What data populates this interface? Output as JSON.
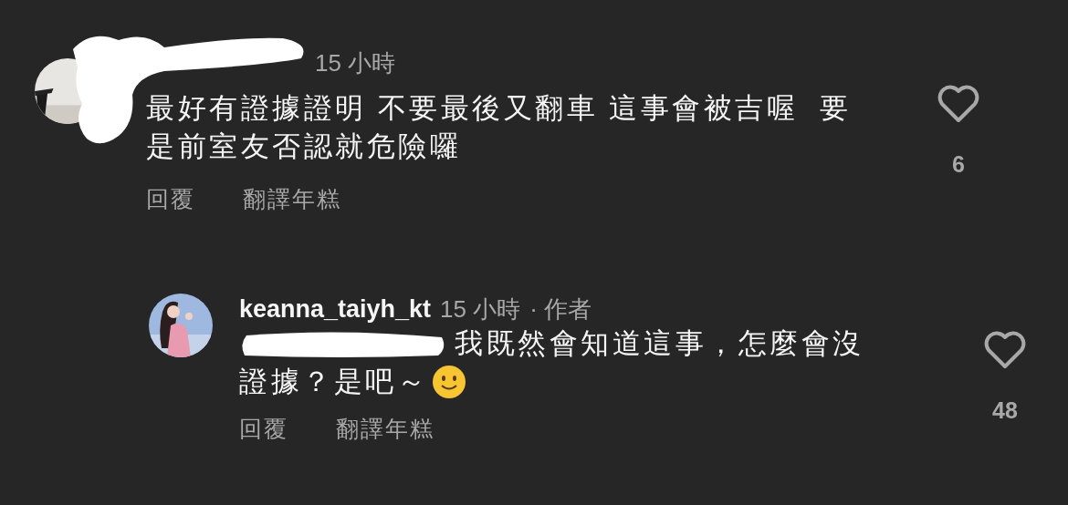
{
  "comments": [
    {
      "kind": "comment",
      "redacted_name": true,
      "time": "15 小時",
      "redacted_mention": false,
      "lines": [
        "最好有證據證明 不要最後又翻車 這事會被吉喔  要",
        "是前室友否認就危險囉"
      ],
      "trailing_emoji": false,
      "actions": [
        "回覆",
        "翻譯年糕"
      ],
      "liked": false,
      "like_count": "6"
    },
    {
      "kind": "reply",
      "redacted_name": false,
      "username": "keanna_taiyh_kt",
      "time": "15 小時",
      "author_tag": "· 作者",
      "redacted_mention": true,
      "lines": [
        "我既然會知道這事，怎麼會沒",
        "證據？是吧～"
      ],
      "trailing_emoji": true,
      "actions": [
        "回覆",
        "翻譯年糕"
      ],
      "liked": false,
      "like_count": "48"
    }
  ]
}
